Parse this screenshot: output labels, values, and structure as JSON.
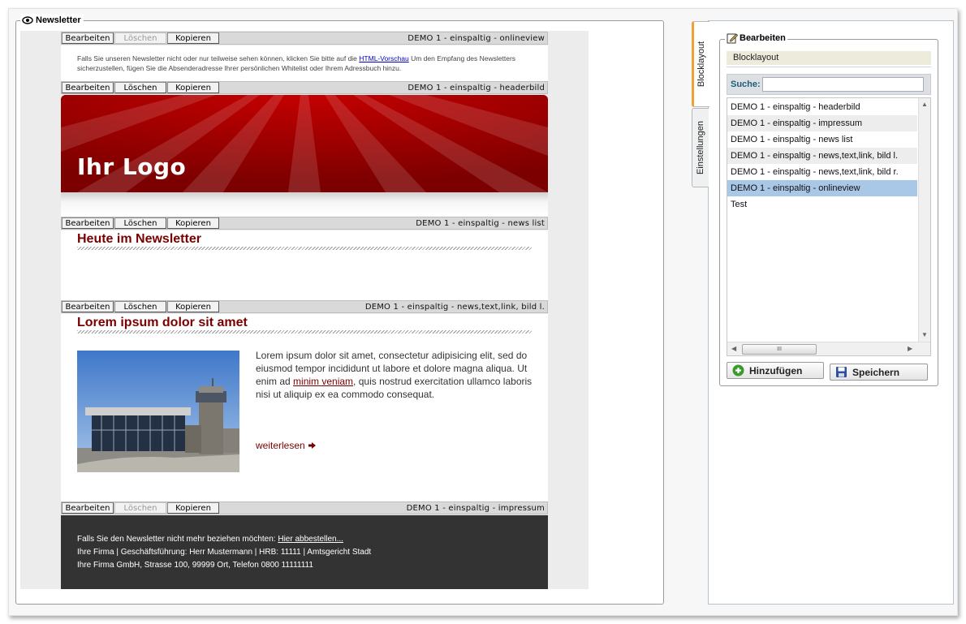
{
  "newsletter": {
    "legend": "Newsletter",
    "buttons": {
      "edit": "Bearbeiten",
      "delete": "Löschen",
      "copy": "Kopieren"
    },
    "blocks": [
      {
        "label": "DEMO 1 - einspaltig - onlineview"
      },
      {
        "label": "DEMO 1 - einspaltig - headerbild"
      },
      {
        "label": "DEMO 1 - einspaltig - news list"
      },
      {
        "label": "DEMO 1 - einspaltig - news,text,link, bild l."
      },
      {
        "label": "DEMO 1 - einspaltig - impressum"
      }
    ],
    "onlineview": {
      "text_before": "Falls Sie unseren Newsletter nicht oder nur teilweise sehen können, klicken Sie bitte auf die ",
      "link": "HTML-Vorschau",
      "text_after": " Um den Empfang des Newsletters sicherzustellen, fügen Sie die Absenderadresse Ihrer persönlichen Whitelist oder Ihrem Adressbuch hinzu."
    },
    "header": {
      "logo": "Ihr Logo"
    },
    "newslist": {
      "title": "Heute im Newsletter"
    },
    "article": {
      "title": "Lorem ipsum dolor sit amet",
      "text_before": "Lorem ipsum dolor sit amet, consectetur adipisicing elit, sed do eiusmod tempor incididunt ut labore et dolore magna aliqua. Ut enim ad ",
      "link": "minim veniam",
      "text_after": ", quis nostrud exercitation ullamco laboris nisi ut aliquip ex ea commodo consequat.",
      "more": "weiterlesen"
    },
    "footer": {
      "line1_text": "Falls Sie den Newsletter nicht mehr beziehen möchten: ",
      "line1_link": "Hier abbestellen...",
      "line2": "Ihre Firma | Geschäftsführung: Herr Mustermann | HRB: 11111 | Amtsgericht Stadt",
      "line3": "Ihre Firma GmbH, Strasse 100, 99999 Ort, Telefon 0800 11111111"
    }
  },
  "sidebar": {
    "tabs": [
      "Blocklayout",
      "Einstellungen"
    ],
    "legend": "Bearbeiten",
    "header": "Blocklayout",
    "search_label": "Suche:",
    "search_value": "",
    "items": [
      "DEMO 1 - einspaltig - headerbild",
      "DEMO 1 - einspaltig - impressum",
      "DEMO 1 - einspaltig - news list",
      "DEMO 1 - einspaltig - news,text,link, bild l.",
      "DEMO 1 - einspaltig - news,text,link, bild r.",
      "DEMO 1 - einspaltig - onlineview",
      "Test"
    ],
    "selected_index": 5,
    "scroll_thumb": "III",
    "add_label": "Hinzufügen",
    "save_label": "Speichern",
    "colors": {
      "selected": "#a9c8e7",
      "accent_tab": "#f0a030",
      "logo_red": "#8e0000"
    }
  }
}
